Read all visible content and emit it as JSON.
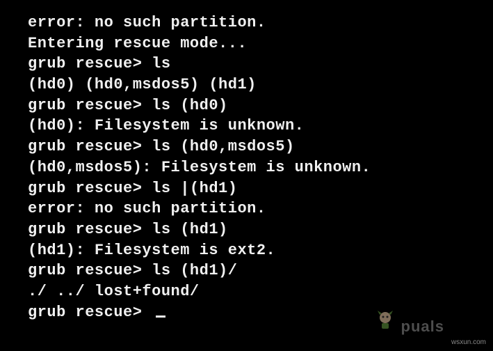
{
  "terminal": {
    "lines": [
      "error: no such partition.",
      "Entering rescue mode...",
      "grub rescue> ls",
      "(hd0) (hd0,msdos5) (hd1)",
      "grub rescue> ls (hd0)",
      "(hd0): Filesystem is unknown.",
      "grub rescue> ls (hd0,msdos5)",
      "(hd0,msdos5): Filesystem is unknown.",
      "grub rescue> ls |(hd1)",
      "error: no such partition.",
      "grub rescue> ls (hd1)",
      "(hd1): Filesystem is ext2.",
      "grub rescue> ls (hd1)/",
      "./ ../ lost+found/",
      "grub rescue> "
    ]
  },
  "watermark": "wsxun.com",
  "logo_text": "puals"
}
